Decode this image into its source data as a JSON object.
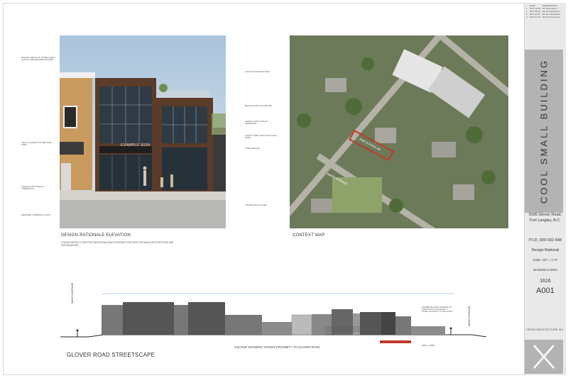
{
  "revisions": {
    "header_date": "DATE",
    "header_desc": "DESCRIPTION",
    "rows": [
      {
        "num": "1",
        "date": "2017-10-28",
        "desc": "DP Submission"
      },
      {
        "num": "2",
        "date": "2017-08-07",
        "desc": "DP Re-Submission"
      },
      {
        "num": "3",
        "date": "2017-11-07",
        "desc": "DP Re-Submission"
      },
      {
        "num": "4",
        "date": "2022-11-02",
        "desc": "DP Re-Submission"
      }
    ]
  },
  "title_block": {
    "project_name": "COOL SMALL BUILDING",
    "address_line1": "9180 Glover Road,",
    "address_line2": "Fort Langley, B.C.",
    "pid": "P.I.D. 009-032-548",
    "sheet_title": "Design Rational",
    "scale": "scale:  1/4\" = 1'-0\"",
    "date": "30 MARCH 2021",
    "project_number": "1616",
    "sheet_number": "A001",
    "firm": "CROSS ARCHITECTURE INC."
  },
  "elevation": {
    "caption": "DESIGN RATIONALE ELEVATION",
    "note": "PLEASE REFER TO WRITTEN DESIGN RATIONAL PROVIDED FOR MORE DETAILED DESCRIPTIONS AND EXPLANATIONS",
    "sign": "EXAMPLE SIGN"
  },
  "context_map": {
    "caption": "CONTEXT MAP",
    "street_label": "MARY AVENUE",
    "site_label": "9180 GLOVER RD"
  },
  "streetscape": {
    "title": "GLOVER ROAD STREETSCAPE",
    "gradient_note": "COLOUR GRADIENT SHOWS PROXIMITY TO GLOVER ROAD",
    "left_street": "MAVIS AVENUE",
    "right_street": "MARY AVENUE",
    "building_note": "STEPPED BUILDING MASSING TO TRANSITION TO ADJACENT 1 STOREY BUILDING TO THE SOUTH",
    "setback_note": "BUILDING MASSING TO FIT WITHIN CONTEXT BY SPLITTING THE BUILDING INTO TWO DISTINCT FORMS ON THE GLOVER ROAD FRONTAGE",
    "site_tag": "PARK & LOBBY"
  },
  "colors": {
    "site_highlight": "#c0392b",
    "title_block_bg": "#e9e9e9",
    "title_block_band": "#b3b3b3"
  }
}
